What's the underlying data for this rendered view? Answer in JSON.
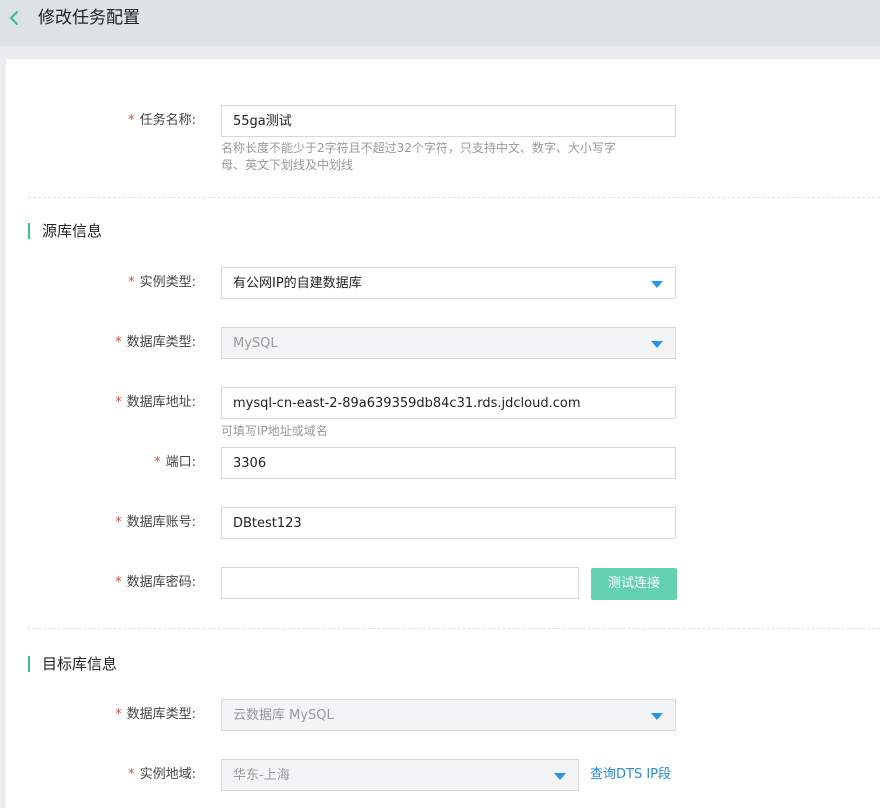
{
  "header": {
    "title": "修改任务配置",
    "back_icon": "chevron-left-icon"
  },
  "task_name": {
    "label": "任务名称:",
    "value": "55ga测试",
    "hint_line1": "名称长度不能少于2字符且不超过32个字符，只支持中文、数字、大小写字",
    "hint_line2": "母、英文下划线及中划线"
  },
  "source": {
    "section_title": "源库信息",
    "instance_type": {
      "label": "实例类型:",
      "value": "有公网IP的自建数据库"
    },
    "db_type": {
      "label": "数据库类型:",
      "value": "MySQL"
    },
    "db_address": {
      "label": "数据库地址:",
      "value": "mysql-cn-east-2-89a639359db84c31.rds.jdcloud.com",
      "hint": "可填写IP地址或域名"
    },
    "port": {
      "label": "端口:",
      "value": "3306"
    },
    "db_account": {
      "label": "数据库账号:",
      "value": "DBtest123"
    },
    "db_password": {
      "label": "数据库密码:",
      "value": ""
    },
    "test_button": "测试连接"
  },
  "target": {
    "section_title": "目标库信息",
    "db_type": {
      "label": "数据库类型:",
      "value": "云数据库 MySQL"
    },
    "region": {
      "label": "实例地域:",
      "value": "华东-上海"
    },
    "query_link": "查询DTS IP段"
  },
  "colors": {
    "accent": "#3fbf9c",
    "button": "#64d1b1",
    "caret": "#2a95e6",
    "required": "#e2483f",
    "link": "#2a8ad8"
  }
}
